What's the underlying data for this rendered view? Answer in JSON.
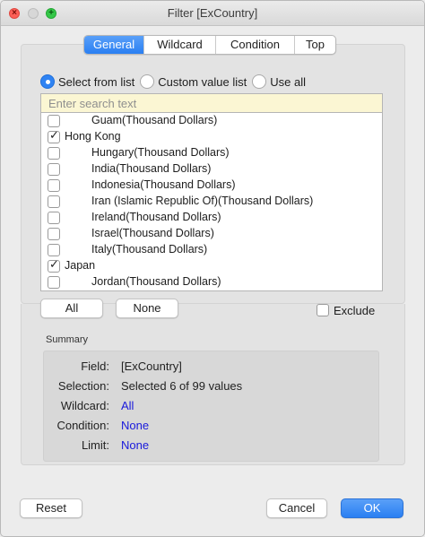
{
  "window": {
    "title": "Filter [ExCountry]"
  },
  "traffic": {
    "close_glyph": "×",
    "max_glyph": "+"
  },
  "tabs": [
    "General",
    "Wildcard",
    "Condition",
    "Top"
  ],
  "radios": [
    {
      "label": "Select from list",
      "checked": true
    },
    {
      "label": "Custom value list",
      "checked": false
    },
    {
      "label": "Use all",
      "checked": false
    }
  ],
  "search": {
    "placeholder": "Enter search text",
    "value": ""
  },
  "list": [
    {
      "label": "Guam(Thousand Dollars)",
      "checked": false,
      "indent": true
    },
    {
      "label": "Hong Kong",
      "checked": true,
      "indent": false
    },
    {
      "label": "Hungary(Thousand Dollars)",
      "checked": false,
      "indent": true
    },
    {
      "label": "India(Thousand Dollars)",
      "checked": false,
      "indent": true
    },
    {
      "label": "Indonesia(Thousand Dollars)",
      "checked": false,
      "indent": true
    },
    {
      "label": "Iran (Islamic Republic Of)(Thousand Dollars)",
      "checked": false,
      "indent": true
    },
    {
      "label": "Ireland(Thousand Dollars)",
      "checked": false,
      "indent": true
    },
    {
      "label": "Israel(Thousand Dollars)",
      "checked": false,
      "indent": true
    },
    {
      "label": "Italy(Thousand Dollars)",
      "checked": false,
      "indent": true
    },
    {
      "label": "Japan",
      "checked": true,
      "indent": false
    },
    {
      "label": "Jordan(Thousand Dollars)",
      "checked": false,
      "indent": true
    }
  ],
  "buttons": {
    "all": "All",
    "none": "None",
    "reset": "Reset",
    "cancel": "Cancel",
    "ok": "OK"
  },
  "exclude": {
    "label": "Exclude",
    "checked": false
  },
  "summary": {
    "heading": "Summary",
    "rows": [
      {
        "key": "Field:",
        "value": "[ExCountry]",
        "link": false
      },
      {
        "key": "Selection:",
        "value": "Selected 6 of 99 values",
        "link": false
      },
      {
        "key": "Wildcard:",
        "value": "All",
        "link": true
      },
      {
        "key": "Condition:",
        "value": "None",
        "link": true
      },
      {
        "key": "Limit:",
        "value": "None",
        "link": true
      }
    ]
  },
  "colors": {
    "accent": "#2f83f3",
    "link": "#1a1adb",
    "search_bg": "#fbf6d3"
  }
}
